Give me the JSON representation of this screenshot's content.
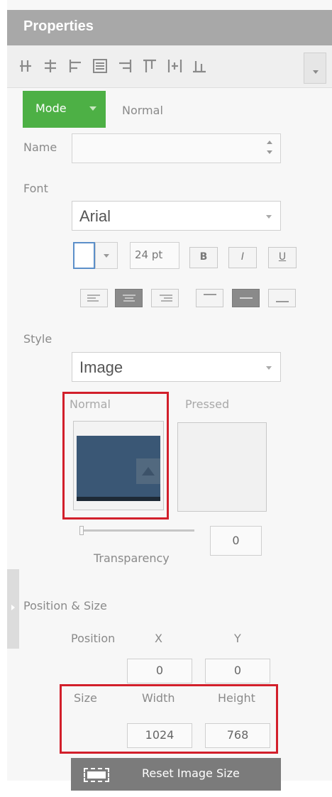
{
  "panel": {
    "title": "Properties"
  },
  "toolbar": {
    "icons": [
      "align-left-edges-icon",
      "align-horizontal-centers-icon",
      "align-left-icon",
      "align-middle-icon",
      "align-right-icon",
      "align-top-icon",
      "distribute-horizontal-icon",
      "align-bottom-icon"
    ],
    "overflow_icon": "chevron-down-icon"
  },
  "mode": {
    "button_label": "Mode",
    "value": "Normal"
  },
  "name": {
    "label": "Name",
    "value": ""
  },
  "font": {
    "label": "Font",
    "family": "Arial",
    "size": "24 pt",
    "bold_label": "B",
    "italic_label": "I",
    "underline_label": "U",
    "color": "#ffffff",
    "alignment_icons": [
      "align-text-left-icon",
      "align-text-center-icon",
      "align-text-right-icon",
      "align-text-top-icon",
      "align-text-middle-icon",
      "align-text-bottom-icon"
    ]
  },
  "style": {
    "label": "Style",
    "value": "Image",
    "normal_label": "Normal",
    "pressed_label": "Pressed",
    "transparency_label": "Transparency",
    "transparency_value": "0"
  },
  "position_size": {
    "section_label": "Position & Size",
    "position_label": "Position",
    "x_label": "X",
    "y_label": "Y",
    "x_value": "0",
    "y_value": "0",
    "size_label": "Size",
    "width_label": "Width",
    "height_label": "Height",
    "width_value": "1024",
    "height_value": "768",
    "reset_label": "Reset Image Size"
  },
  "colors": {
    "header_bg": "#a8a8a8",
    "mode_green": "#4db045",
    "highlight_red": "#d21f2b",
    "image_blue": "#3a5775"
  }
}
